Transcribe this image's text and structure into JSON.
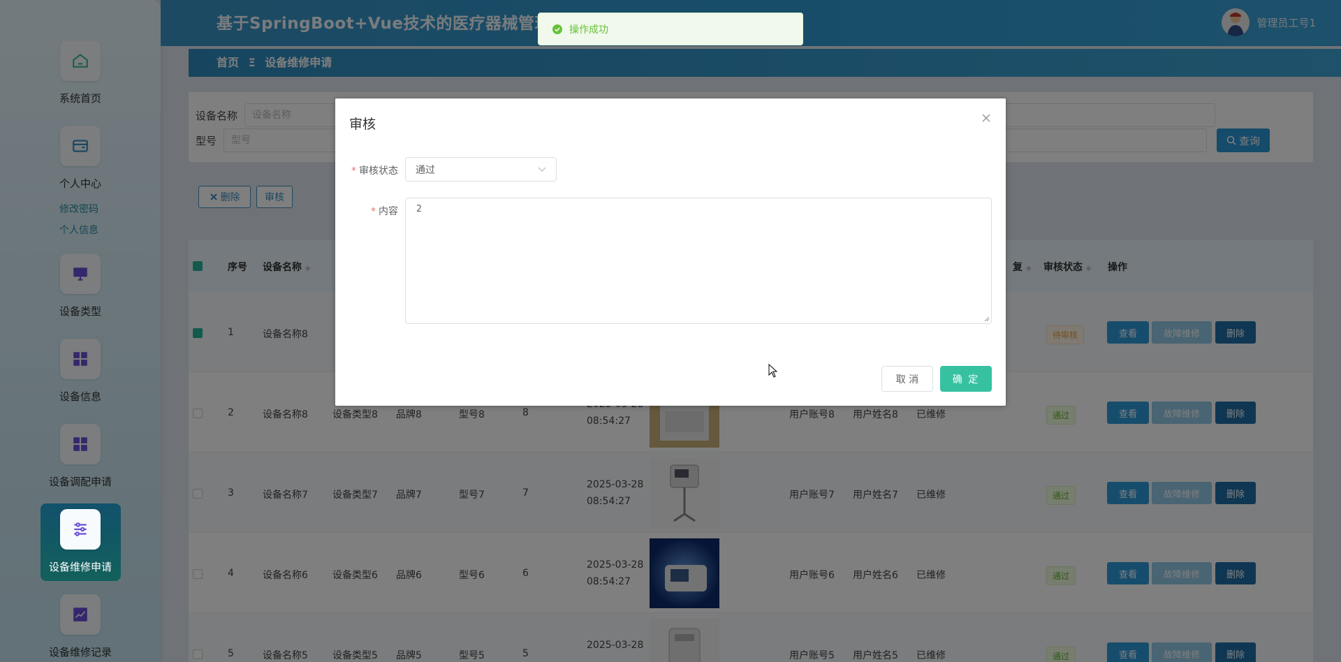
{
  "header": {
    "title": "基于SpringBoot+Vue技术的医疗器械管理",
    "user_name": "管理员工号1"
  },
  "breadcrumb": {
    "home": "首页",
    "separator": "Ξ",
    "current": "设备维修申请"
  },
  "sidebar": {
    "items": [
      {
        "label": "系统首页",
        "icon": "home-icon"
      },
      {
        "label": "个人中心",
        "icon": "wallet-icon",
        "sub": [
          "修改密码",
          "个人信息"
        ]
      },
      {
        "label": "设备类型",
        "icon": "monitor-icon"
      },
      {
        "label": "设备信息",
        "icon": "grid-icon"
      },
      {
        "label": "设备调配申请",
        "icon": "grid-icon"
      },
      {
        "label": "设备维修申请",
        "icon": "sliders-icon",
        "active": true
      },
      {
        "label": "设备维修记录",
        "icon": "chart-icon"
      }
    ]
  },
  "search": {
    "device_name_label": "设备名称",
    "device_name_placeholder": "设备名称",
    "model_label": "型号",
    "model_placeholder": "型号",
    "query_label": "查询"
  },
  "actions": {
    "delete_label": "删除",
    "audit_label": "审核"
  },
  "table": {
    "headers": {
      "index": "序号",
      "device_name": "设备名称",
      "repair": "复",
      "audit_status": "审核状态",
      "operation": "操作"
    },
    "rows": [
      {
        "index": "1",
        "device_name": "设备名称8",
        "status": "待审核",
        "status_type": "pending",
        "checked": true
      },
      {
        "index": "2",
        "device_name": "设备名称8",
        "type": "设备类型8",
        "brand": "品牌8",
        "model": "型号8",
        "qty": "8",
        "date": "2025-03-28",
        "time": "08:54:27",
        "account": "用户账号8",
        "user": "用户姓名8",
        "repair": "已维修",
        "status": "通过",
        "status_type": "pass"
      },
      {
        "index": "3",
        "device_name": "设备名称7",
        "type": "设备类型7",
        "brand": "品牌7",
        "model": "型号7",
        "qty": "7",
        "date": "2025-03-28",
        "time": "08:54:27",
        "account": "用户账号7",
        "user": "用户姓名7",
        "repair": "已维修",
        "status": "通过",
        "status_type": "pass"
      },
      {
        "index": "4",
        "device_name": "设备名称6",
        "type": "设备类型6",
        "brand": "品牌6",
        "model": "型号6",
        "qty": "6",
        "date": "2025-03-28",
        "time": "08:54:27",
        "account": "用户账号6",
        "user": "用户姓名6",
        "repair": "已维修",
        "status": "通过",
        "status_type": "pass"
      },
      {
        "index": "5",
        "device_name": "设备名称5",
        "type": "设备类型5",
        "brand": "品牌5",
        "model": "型号5",
        "qty": "5",
        "date": "2025-03-28",
        "account": "用户账号5",
        "user": "用户姓名5",
        "repair": "已维修",
        "status": "通过",
        "status_type": "pass"
      }
    ],
    "op_labels": {
      "view": "查看",
      "repair": "故障维修",
      "delete": "删除"
    }
  },
  "toast": {
    "message": "操作成功"
  },
  "dialog": {
    "title": "审核",
    "status_label": "审核状态",
    "status_value": "通过",
    "content_label": "内容",
    "content_value": "2",
    "cancel_label": "取 消",
    "confirm_label": "确 定"
  },
  "colors": {
    "accent": "#2e9ad8",
    "confirm": "#36c2a0",
    "success": "#67c23a",
    "pending": "#e8a13a"
  }
}
